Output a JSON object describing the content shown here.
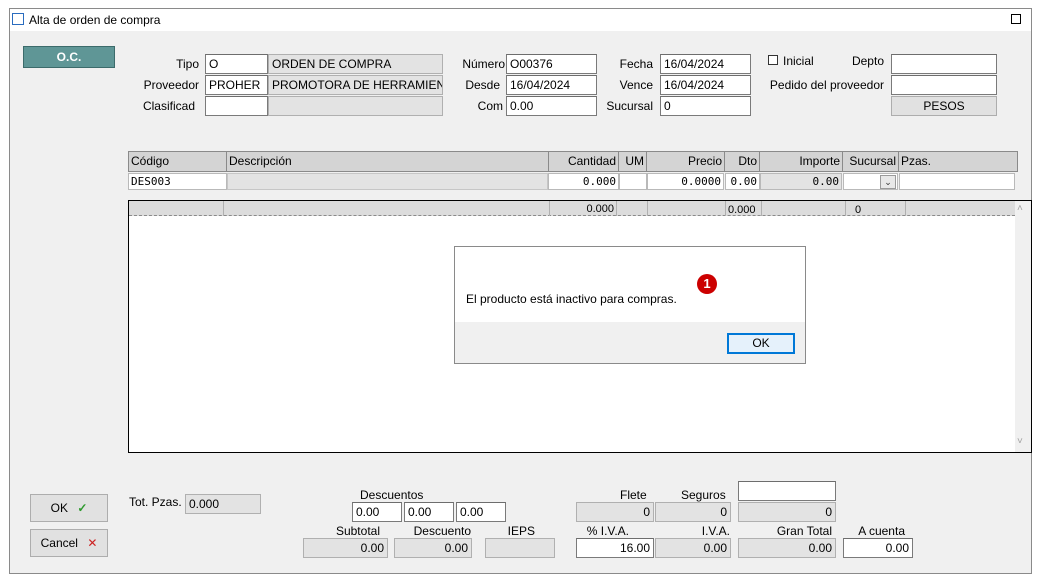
{
  "window": {
    "title": "Alta de orden de compra"
  },
  "oc_tab": "O.C.",
  "header": {
    "tipo_label": "Tipo",
    "tipo_code": "O",
    "tipo_desc": "ORDEN DE COMPRA",
    "proveedor_label": "Proveedor",
    "proveedor_code": "PROHER",
    "proveedor_desc": "PROMOTORA DE HERRAMIENTAS",
    "clasificad_label": "Clasificad",
    "clasificad_code": "",
    "clasificad_desc": "",
    "numero_label": "Número",
    "numero_value": "O00376",
    "desde_label": "Desde",
    "desde_value": "16/04/2024",
    "com_label": "Com",
    "com_value": "0.00",
    "fecha_label": "Fecha",
    "fecha_value": "16/04/2024",
    "vence_label": "Vence",
    "vence_value": "16/04/2024",
    "sucursal_label": "Sucursal",
    "sucursal_value": "0",
    "inicial_label": "Inicial",
    "depto_label": "Depto",
    "depto_value": "",
    "pedido_label": "Pedido del proveedor",
    "pedido_value": "",
    "moneda_button": "PESOS"
  },
  "grid": {
    "columns": [
      "Código",
      "Descripción",
      "Cantidad",
      "UM",
      "Precio",
      "Dto",
      "Importe",
      "Sucursal",
      "Pzas."
    ],
    "entry": {
      "codigo": "DES003",
      "cantidad": "0.000",
      "precio": "0.0000",
      "dto": "0.00",
      "importe": "0.00"
    },
    "totals": {
      "cantidad": "0.000",
      "dto": "0.000",
      "sucursal": "0"
    }
  },
  "dialog": {
    "message": "El producto está inactivo para compras.",
    "ok_label": "OK",
    "badge": "1"
  },
  "footer": {
    "ok_label": "OK",
    "cancel_label": "Cancel",
    "tot_pzas_label": "Tot. Pzas.",
    "tot_pzas_value": "0.000",
    "descuentos_label": "Descuentos",
    "desc1": "0.00",
    "desc2": "0.00",
    "desc3": "0.00",
    "flete_label": "Flete",
    "flete_value": "0",
    "seguros_label": "Seguros",
    "seguros_value": "0",
    "seguros_top_value": "",
    "subtotal_label": "Subtotal",
    "subtotal_value": "0.00",
    "descuento_label": "Descuento",
    "descuento_value": "0.00",
    "ieps_label": "IEPS",
    "ieps_value": "",
    "piva_label": "% I.V.A.",
    "piva_value": "16.00",
    "iva_label": "I.V.A.",
    "iva_value": "0.00",
    "gran_total_label": "Gran Total",
    "gran_total_value": "0.00",
    "a_cuenta_label": "A cuenta",
    "a_cuenta_value": "0.00"
  },
  "colors": {
    "oc_tab": "#5f9696",
    "dialog_ok_border": "#0078d7",
    "badge": "#cc0000",
    "ok_check": "#2e9a2e",
    "cancel_x": "#cc2222"
  }
}
